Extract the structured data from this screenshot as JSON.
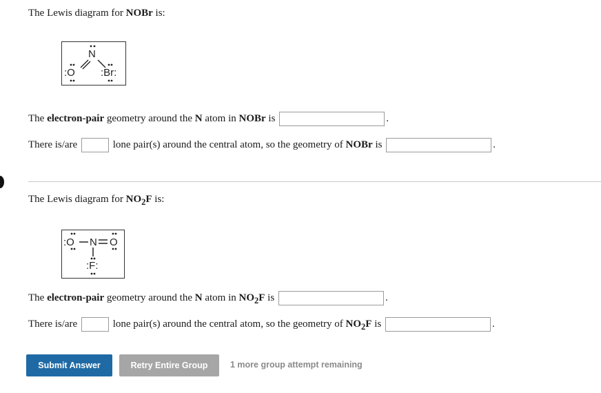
{
  "q1": {
    "intro": {
      "prefix": "The Lewis diagram for ",
      "formula": "NOBr",
      "suffix": " is:"
    },
    "lewis": {
      "n": "N",
      "o": ":O",
      "br": ":Br:"
    },
    "epg": {
      "p1": "The ",
      "b1": "electron-pair",
      "p2": " geometry around the ",
      "b2": "N",
      "p3": " atom in ",
      "formula": "NOBr",
      "p4": " is",
      "end": "."
    },
    "lone": {
      "p1": "There is/are",
      "p2": "lone pair(s) around the central atom, so the geometry of ",
      "formula": "NOBr",
      "p3": " is",
      "end": "."
    }
  },
  "q2": {
    "intro": {
      "prefix": "The Lewis diagram for ",
      "formula_base": "NO",
      "formula_sub": "2",
      "formula_tail": "F",
      "suffix": " is:"
    },
    "lewis": {
      "o1": ":O",
      "n": "N",
      "o2": "O",
      "f": ":F:"
    },
    "epg": {
      "p1": "The ",
      "b1": "electron-pair",
      "p2": " geometry around the ",
      "b2": "N",
      "p3": " atom in ",
      "formula_base": "NO",
      "formula_sub": "2",
      "formula_tail": "F",
      "p4": " is",
      "end": "."
    },
    "lone": {
      "p1": "There is/are",
      "p2": "lone pair(s) around the central atom, so the geometry of ",
      "formula_base": "NO",
      "formula_sub": "2",
      "formula_tail": "F",
      "p3": " is",
      "end": "."
    }
  },
  "buttons": {
    "submit": "Submit Answer",
    "retry": "Retry Entire Group"
  },
  "status": {
    "remaining": "1 more group attempt remaining"
  },
  "colors": {
    "submit": "#1f6aa5",
    "retry": "#a6a6a6",
    "remaining": "#8a8a8a"
  }
}
